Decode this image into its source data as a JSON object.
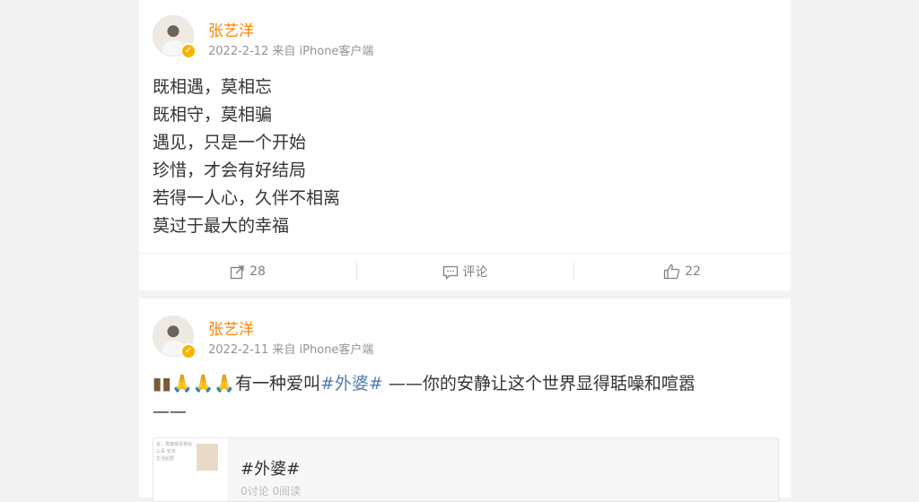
{
  "posts": [
    {
      "author": "张艺洋",
      "meta": "2022-2-12 来自 iPhone客户端",
      "lines": [
        "既相遇，莫相忘",
        "既相守，莫相骗",
        "遇见，只是一个开始",
        "珍惜，才会有好结局",
        "若得一人心，久伴不相离",
        "莫过于最大的幸福"
      ],
      "actions": {
        "repost": "28",
        "comment": "评论",
        "like": "22"
      }
    },
    {
      "author": "张艺洋",
      "meta": "2022-2-11 来自 iPhone客户端",
      "text_before": "有一种爱叫",
      "hashtag": "#外婆#",
      "text_after": " ——你的安静让这个世界显得聒噪和喧嚣",
      "text_tail": "——",
      "embed": {
        "title": "#外婆#",
        "sub": "0讨论 0阅读",
        "thumb_lines": [
          "友，再春暖青春给",
          "三百  安卓",
          "生活起居"
        ]
      }
    }
  ],
  "icons": {
    "verified": "verified-badge-icon",
    "repost": "repost-icon",
    "comment": "comment-icon",
    "like": "like-icon"
  },
  "colors": {
    "name": "#ff8200",
    "hashtag": "#507daf",
    "meta": "#939393"
  }
}
